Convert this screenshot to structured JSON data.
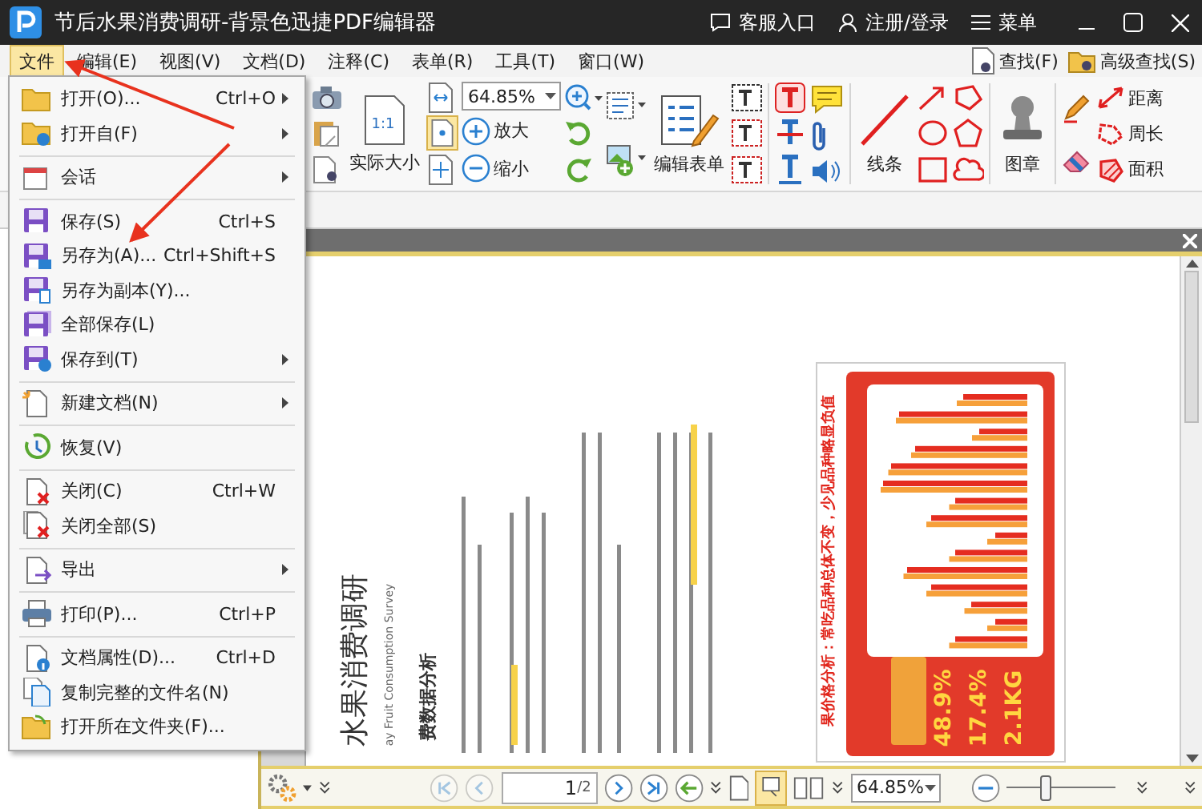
{
  "title_bar": {
    "title": "节后水果消费调研-背景色迅捷PDF编辑器",
    "actions": [
      "客服入口",
      "注册/登录",
      "菜单"
    ]
  },
  "menu_bar": {
    "items": [
      {
        "label": "文件",
        "selected": true
      },
      {
        "label": "编辑(E)",
        "selected": false
      },
      {
        "label": "视图(V)",
        "selected": false
      },
      {
        "label": "文档(D)",
        "selected": false
      },
      {
        "label": "注释(C)",
        "selected": false
      },
      {
        "label": "表单(R)",
        "selected": false
      },
      {
        "label": "工具(T)",
        "selected": false
      },
      {
        "label": "窗口(W)",
        "selected": false
      }
    ],
    "search_buttons": [
      "查找(F)",
      "高级查找(S)"
    ]
  },
  "toolbar": {
    "actual_size_glyph": "1:1",
    "actual_size": "实际大小",
    "zoom": "64.85%",
    "zoom_in": "放大",
    "zoom_out": "缩小",
    "edit_form": "编辑表单",
    "lines": "线条",
    "stamp": "图章",
    "distance": "距离",
    "perimeter": "周长",
    "area": "面积"
  },
  "file_menu": {
    "groups": [
      [
        {
          "label": "打开(O)...",
          "shortcut": "Ctrl+O",
          "submenu": true
        },
        {
          "label": "打开自(F)",
          "submenu": true
        }
      ],
      [
        {
          "label": "会话",
          "submenu": true
        }
      ],
      [
        {
          "label": "保存(S)",
          "shortcut": "Ctrl+S",
          "submenu": false
        },
        {
          "label": "另存为(A)...",
          "shortcut": "Ctrl+Shift+S",
          "submenu": false
        },
        {
          "label": "另存为副本(Y)...",
          "submenu": false
        },
        {
          "label": "全部保存(L)",
          "submenu": false
        },
        {
          "label": "保存到(T)",
          "submenu": true
        }
      ],
      [
        {
          "label": "新建文档(N)",
          "submenu": true
        }
      ],
      [
        {
          "label": "恢复(V)",
          "submenu": false
        }
      ],
      [
        {
          "label": "关闭(C)",
          "shortcut": "Ctrl+W",
          "submenu": false
        },
        {
          "label": "关闭全部(S)",
          "submenu": false
        }
      ],
      [
        {
          "label": "导出",
          "submenu": true
        }
      ],
      [
        {
          "label": "打印(P)...",
          "shortcut": "Ctrl+P",
          "submenu": false
        }
      ],
      [
        {
          "label": "文档属性(D)...",
          "shortcut": "Ctrl+D",
          "submenu": false
        },
        {
          "label": "复制完整的文件名(N)",
          "submenu": false
        },
        {
          "label": "打开所在文件夹(F)...",
          "submenu": false
        }
      ]
    ]
  },
  "document": {
    "title": "水果消费调研",
    "subtitle": "ay Fruit Consumption Survey",
    "section": "费数据分析",
    "chart_panel": {
      "headline": "果价格分析：常吃品种总体不变，少见品种略显负值",
      "stats": [
        "48.9%",
        "17.4%",
        "2.1KG"
      ]
    }
  },
  "bottom_bar": {
    "nav_buttons": [
      {
        "disabled": true
      },
      {
        "disabled": true
      },
      {
        "disabled": false
      },
      {
        "disabled": false
      }
    ],
    "page": "1",
    "page_total": "/2",
    "zoom": "64.85%",
    "zoom_slider": {
      "level": 0.35
    }
  }
}
